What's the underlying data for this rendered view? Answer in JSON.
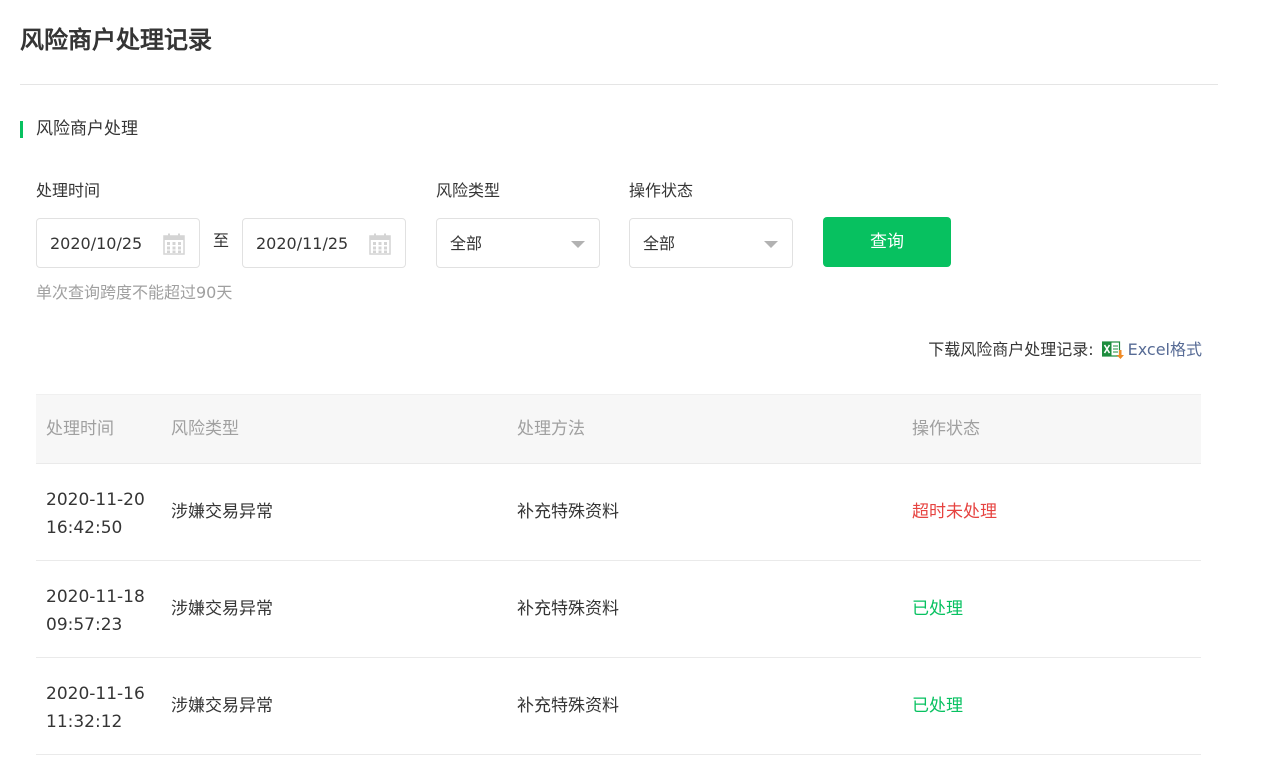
{
  "page": {
    "title": "风险商户处理记录"
  },
  "section": {
    "title": "风险商户处理"
  },
  "filters": {
    "time_label": "处理时间",
    "start_date": "2020/10/25",
    "range_separator": "至",
    "end_date": "2020/11/25",
    "risk_type_label": "风险类型",
    "risk_type_value": "全部",
    "status_label": "操作状态",
    "status_value": "全部",
    "query_button": "查询",
    "hint": "单次查询跨度不能超过90天"
  },
  "download": {
    "label": "下载风险商户处理记录:",
    "link": "Excel格式",
    "icon": "excel-icon"
  },
  "table": {
    "headers": [
      "处理时间",
      "风险类型",
      "处理方法",
      "操作状态"
    ],
    "rows": [
      {
        "time": "2020-11-20 16:42:50",
        "type": "涉嫌交易异常",
        "method": "补充特殊资料",
        "status": "超时未处理",
        "status_kind": "overdue"
      },
      {
        "time": "2020-11-18 09:57:23",
        "type": "涉嫌交易异常",
        "method": "补充特殊资料",
        "status": "已处理",
        "status_kind": "done"
      },
      {
        "time": "2020-11-16 11:32:12",
        "type": "涉嫌交易异常",
        "method": "补充特殊资料",
        "status": "已处理",
        "status_kind": "done"
      }
    ]
  },
  "colors": {
    "accent": "#07c160",
    "link": "#576b95",
    "overdue": "#e64340",
    "done": "#07c160"
  }
}
